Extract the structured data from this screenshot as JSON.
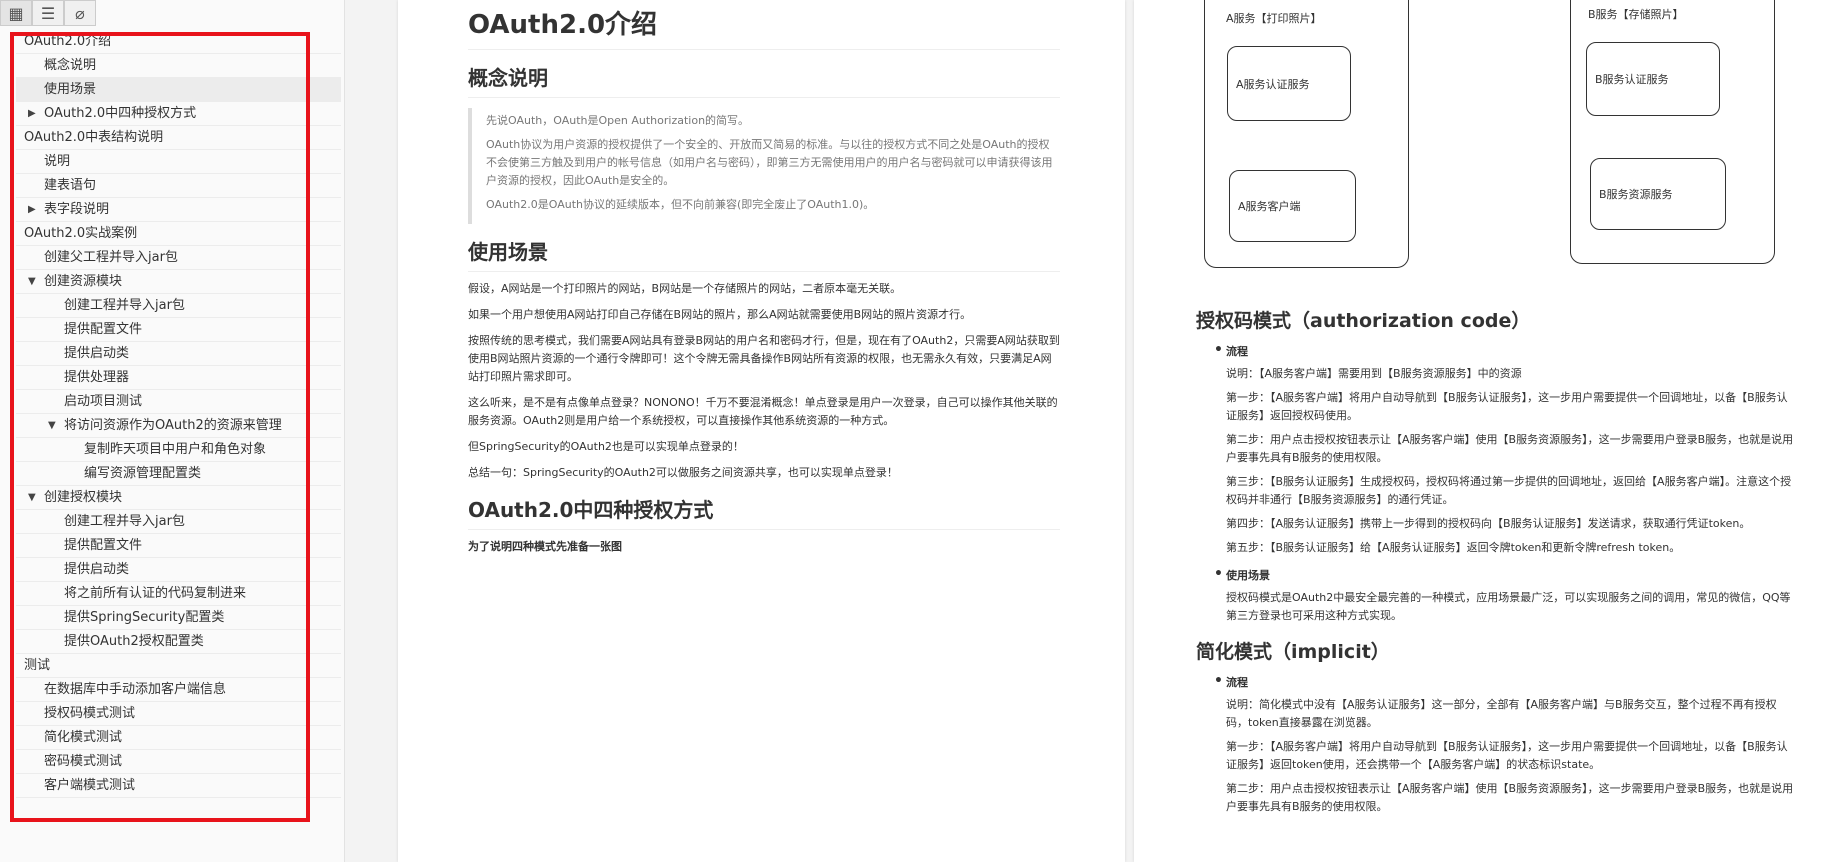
{
  "toolbar": {
    "buttons": [
      {
        "name": "grid-view-icon",
        "glyph": "▦"
      },
      {
        "name": "list-view-icon",
        "glyph": "☰"
      },
      {
        "name": "attachment-icon",
        "glyph": "⌀"
      }
    ]
  },
  "toc": [
    {
      "label": "OAuth2.0介绍",
      "level": 0,
      "arrow": ""
    },
    {
      "label": "概念说明",
      "level": 1,
      "arrow": ""
    },
    {
      "label": "使用场景",
      "level": 1,
      "arrow": "",
      "selected": true
    },
    {
      "label": "OAuth2.0中四种授权方式",
      "level": 1,
      "arrow": "▶"
    },
    {
      "label": "OAuth2.0中表结构说明",
      "level": 0,
      "arrow": ""
    },
    {
      "label": "说明",
      "level": 1,
      "arrow": ""
    },
    {
      "label": "建表语句",
      "level": 1,
      "arrow": ""
    },
    {
      "label": "表字段说明",
      "level": 1,
      "arrow": "▶"
    },
    {
      "label": "OAuth2.0实战案例",
      "level": 0,
      "arrow": ""
    },
    {
      "label": "创建父工程并导入jar包",
      "level": 1,
      "arrow": ""
    },
    {
      "label": "创建资源模块",
      "level": 1,
      "arrow": "▼"
    },
    {
      "label": "创建工程并导入jar包",
      "level": 2,
      "arrow": ""
    },
    {
      "label": "提供配置文件",
      "level": 2,
      "arrow": ""
    },
    {
      "label": "提供启动类",
      "level": 2,
      "arrow": ""
    },
    {
      "label": "提供处理器",
      "level": 2,
      "arrow": ""
    },
    {
      "label": "启动项目测试",
      "level": 2,
      "arrow": ""
    },
    {
      "label": "将访问资源作为OAuth2的资源来管理",
      "level": 2,
      "arrow": "▼"
    },
    {
      "label": "复制昨天项目中用户和角色对象",
      "level": 3,
      "arrow": ""
    },
    {
      "label": "编写资源管理配置类",
      "level": 3,
      "arrow": ""
    },
    {
      "label": "创建授权模块",
      "level": 1,
      "arrow": "▼"
    },
    {
      "label": "创建工程并导入jar包",
      "level": 2,
      "arrow": ""
    },
    {
      "label": "提供配置文件",
      "level": 2,
      "arrow": ""
    },
    {
      "label": "提供启动类",
      "level": 2,
      "arrow": ""
    },
    {
      "label": "将之前所有认证的代码复制进来",
      "level": 2,
      "arrow": ""
    },
    {
      "label": "提供SpringSecurity配置类",
      "level": 2,
      "arrow": ""
    },
    {
      "label": "提供OAuth2授权配置类",
      "level": 2,
      "arrow": ""
    },
    {
      "label": "测试",
      "level": 0,
      "arrow": ""
    },
    {
      "label": "在数据库中手动添加客户端信息",
      "level": 1,
      "arrow": ""
    },
    {
      "label": "授权码模式测试",
      "level": 1,
      "arrow": ""
    },
    {
      "label": "简化模式测试",
      "level": 1,
      "arrow": ""
    },
    {
      "label": "密码模式测试",
      "level": 1,
      "arrow": ""
    },
    {
      "label": "客户端模式测试",
      "level": 1,
      "arrow": ""
    }
  ],
  "page1": {
    "title": "OAuth2.0介绍",
    "concept": {
      "heading": "概念说明",
      "quote": [
        "先说OAuth，OAuth是Open Authorization的简写。",
        "OAuth协议为用户资源的授权提供了一个安全的、开放而又简易的标准。与以往的授权方式不同之处是OAuth的授权不会使第三方触及到用户的帐号信息（如用户名与密码），即第三方无需使用用户的用户名与密码就可以申请获得该用户资源的授权，因此OAuth是安全的。",
        "OAuth2.0是OAuth协议的延续版本，但不向前兼容(即完全废止了OAuth1.0)。"
      ]
    },
    "usage": {
      "heading": "使用场景",
      "paragraphs": [
        "假设，A网站是一个打印照片的网站，B网站是一个存储照片的网站，二者原本毫无关联。",
        "如果一个用户想使用A网站打印自己存储在B网站的照片，那么A网站就需要使用B网站的照片资源才行。",
        "按照传统的思考模式，我们需要A网站具有登录B网站的用户名和密码才行，但是，现在有了OAuth2，只需要A网站获取到使用B网站照片资源的一个通行令牌即可！这个令牌无需具备操作B网站所有资源的权限，也无需永久有效，只要满足A网站打印照片需求即可。",
        "这么听来，是不是有点像单点登录？NONONO！千万不要混淆概念！单点登录是用户一次登录，自己可以操作其他关联的服务资源。OAuth2则是用户给一个系统授权，可以直接操作其他系统资源的一种方式。",
        "但SpringSecurity的OAuth2也是可以实现单点登录的！",
        "总结一句：SpringSecurity的OAuth2可以做服务之间资源共享，也可以实现单点登录！"
      ]
    },
    "modes": {
      "heading": "OAuth2.0中四种授权方式",
      "intro": "为了说明四种模式先准备一张图"
    }
  },
  "diagram": {
    "a_title": "A服务【打印照片】",
    "b_title": "B服务【存储照片】",
    "a_auth": "A服务认证服务",
    "a_client": "A服务客户端",
    "b_auth": "B服务认证服务",
    "b_resource": "B服务资源服务"
  },
  "page2": {
    "auth_code": {
      "heading": "授权码模式（authorization code）",
      "flow_title": "流程",
      "flow": [
        "说明：【A服务客户端】需要用到【B服务资源服务】中的资源",
        "第一步：【A服务客户端】将用户自动导航到【B服务认证服务】，这一步用户需要提供一个回调地址，以备【B服务认证服务】返回授权码使用。",
        "第二步：用户点击授权按钮表示让【A服务客户端】使用【B服务资源服务】，这一步需要用户登录B服务，也就是说用户要事先具有B服务的使用权限。",
        "第三步：【B服务认证服务】生成授权码，授权码将通过第一步提供的回调地址，返回给【A服务客户端】。注意这个授权码并非通行【B服务资源服务】的通行凭证。",
        "第四步：【A服务认证服务】携带上一步得到的授权码向【B服务认证服务】发送请求，获取通行凭证token。",
        "第五步：【B服务认证服务】给【A服务认证服务】返回令牌token和更新令牌refresh token。"
      ],
      "usage_title": "使用场景",
      "usage": "授权码模式是OAuth2中最安全最完善的一种模式，应用场景最广泛，可以实现服务之间的调用，常见的微信，QQ等第三方登录也可采用这种方式实现。"
    },
    "implicit": {
      "heading": "简化模式（implicit）",
      "flow_title": "流程",
      "flow": [
        "说明：简化模式中没有【A服务认证服务】这一部分，全部有【A服务客户端】与B服务交互，整个过程不再有授权码，token直接暴露在浏览器。",
        "第一步：【A服务客户端】将用户自动导航到【B服务认证服务】，这一步用户需要提供一个回调地址，以备【B服务认证服务】返回token使用，还会携带一个【A服务客户端】的状态标识state。",
        "第二步：用户点击授权按钮表示让【A服务客户端】使用【B服务资源服务】，这一步需要用户登录B服务，也就是说用户要事先具有B服务的使用权限。"
      ]
    }
  }
}
